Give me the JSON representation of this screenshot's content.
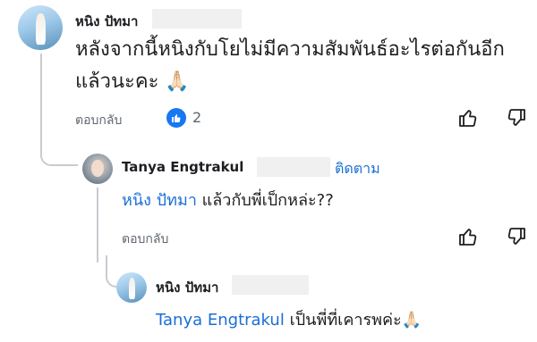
{
  "comment": {
    "author": "หนิง ปัทมา",
    "text_line1": "หลังจากนี้หนิงกับโยไม่มีความสัมพันธ์อะไรต่อกันอีก",
    "text_line2": "แล้วนะคะ 🙏🏻",
    "reply_label": "ตอบกลับ",
    "like_count": "2"
  },
  "reply1": {
    "author": "Tanya Engtrakul",
    "follow_label": "ติดตาม",
    "mention": "หนิง ปัทมา",
    "text": " แล้วกับพี่เป็กหล่ะ??",
    "reply_label": "ตอบกลับ"
  },
  "reply2": {
    "author": "หนิง ปัทมา",
    "mention": "Tanya Engtrakul",
    "text": " เป็นพี่ที่เคารพค่ะ🙏🏻"
  },
  "colors": {
    "link": "#1a6ed8",
    "like_badge": "#1877f2",
    "muted": "#606770"
  },
  "icons": [
    "thumbs-up-icon",
    "thumbs-down-icon",
    "like-reaction-icon"
  ]
}
